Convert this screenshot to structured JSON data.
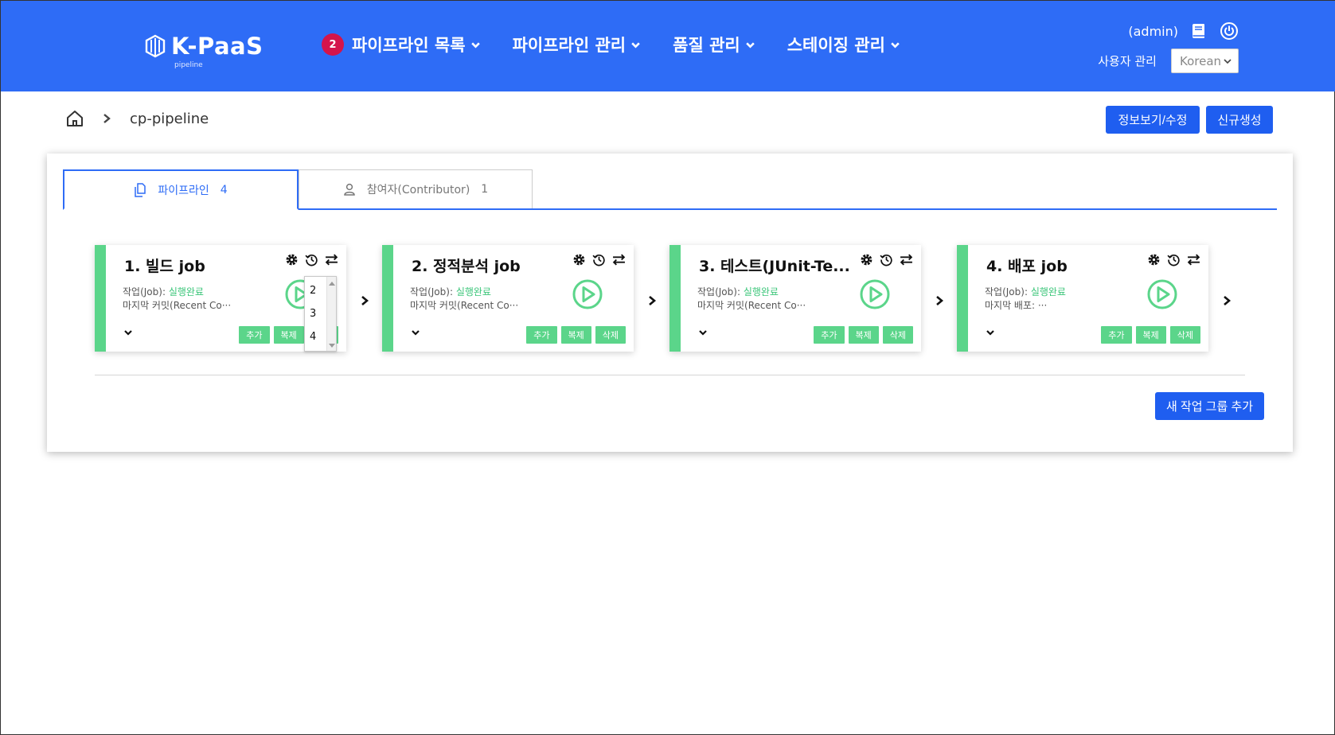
{
  "header": {
    "logo": "K-PaaS",
    "logo_sub": "pipeline",
    "menu": [
      {
        "label": "파이프라인 목록",
        "badge": "2"
      },
      {
        "label": "파이프라인 관리"
      },
      {
        "label": "품질 관리"
      },
      {
        "label": "스테이징 관리"
      }
    ],
    "user": "(admin)",
    "user_manage": "사용자 관리",
    "language": "Korean",
    "bg_color": "#2e6cf6"
  },
  "breadcrumb": {
    "current": "cp-pipeline"
  },
  "actions": {
    "info_edit": "정보보기/수정",
    "create_new": "신규생성"
  },
  "tabs": [
    {
      "label": "파이프라인",
      "count": "4",
      "active": true
    },
    {
      "label": "참여자(Contributor)",
      "count": "1",
      "active": false
    }
  ],
  "jobs": [
    {
      "title": "1. 빌드 job",
      "status_label": "작업(Job): ",
      "status": "실행완료",
      "detail": "마지막 커밋(Recent Co···",
      "add": "추가",
      "copy": "복제",
      "delete": "삭제"
    },
    {
      "title": "2. 정적분석 job",
      "status_label": "작업(Job): ",
      "status": "실행완료",
      "detail": "마지막 커밋(Recent Co···",
      "add": "추가",
      "copy": "복제",
      "delete": "삭제"
    },
    {
      "title": "3. 테스트(JUnit-Te...",
      "status_label": "작업(Job): ",
      "status": "실행완료",
      "detail": "마지막 커밋(Recent Co···",
      "add": "추가",
      "copy": "복제",
      "delete": "삭제"
    },
    {
      "title": "4. 배포 job",
      "status_label": "작업(Job): ",
      "status": "실행완료",
      "detail": "마지막 배포: ···",
      "add": "추가",
      "copy": "복제",
      "delete": "삭제"
    }
  ],
  "order_dropdown": {
    "options": [
      "2",
      "3",
      "4"
    ]
  },
  "add_group": "새 작업 그룹 추가",
  "colors": {
    "primary": "#2e6cf6",
    "success": "#5bd58a",
    "badge": "#d4144b"
  }
}
